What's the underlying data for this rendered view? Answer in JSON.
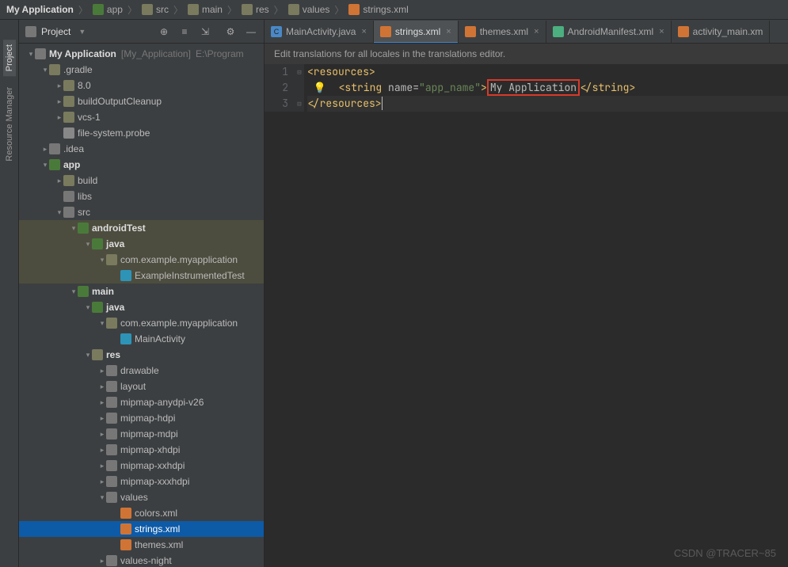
{
  "breadcrumb": {
    "root": "My Application",
    "items": [
      "app",
      "src",
      "main",
      "res",
      "values"
    ],
    "file": "strings.xml"
  },
  "side_tabs": {
    "project": "Project",
    "resource_mgr": "Resource Manager"
  },
  "pane": {
    "title": "Project"
  },
  "tree": {
    "root_name": "My Application",
    "root_tag": "[My_Application]",
    "root_path": "E:\\Program",
    "gradle": ".gradle",
    "gradle_80": "8.0",
    "build_output": "buildOutputCleanup",
    "vcs": "vcs-1",
    "fsprobe": "file-system.probe",
    "idea": ".idea",
    "app": "app",
    "build": "build",
    "libs": "libs",
    "src": "src",
    "androidTest": "androidTest",
    "java": "java",
    "pkg": "com.example.myapplication",
    "instr_test": "ExampleInstrumentedTest",
    "main": "main",
    "main_activity": "MainActivity",
    "res": "res",
    "drawable": "drawable",
    "layout": "layout",
    "mip_any": "mipmap-anydpi-v26",
    "mip_h": "mipmap-hdpi",
    "mip_m": "mipmap-mdpi",
    "mip_xh": "mipmap-xhdpi",
    "mip_xxh": "mipmap-xxhdpi",
    "mip_xxxh": "mipmap-xxxhdpi",
    "values": "values",
    "colors": "colors.xml",
    "strings": "strings.xml",
    "themes": "themes.xml",
    "values_night": "values-night"
  },
  "tabs": {
    "t1": "MainActivity.java",
    "t2": "strings.xml",
    "t3": "themes.xml",
    "t4": "AndroidManifest.xml",
    "t5": "activity_main.xm"
  },
  "hint": "Edit translations for all locales in the translations editor.",
  "code": {
    "ln1": "1",
    "ln2": "2",
    "ln3": "3",
    "l1_open": "<resources>",
    "l2_tag_open": "<string",
    "l2_attr": " name=",
    "l2_val": "\"app_name\"",
    "l2_gt": ">",
    "l2_text": "My Application",
    "l2_close": "</string>",
    "l3_close": "</resources>"
  },
  "watermark": "CSDN @TRACER~85"
}
